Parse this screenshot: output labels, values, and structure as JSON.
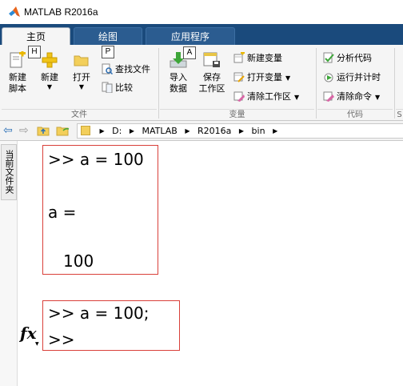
{
  "window": {
    "title": "MATLAB R2016a"
  },
  "tabs": [
    {
      "label": "主页",
      "active": true
    },
    {
      "label": "绘图",
      "active": false
    },
    {
      "label": "应用程序",
      "active": false
    }
  ],
  "keytips": {
    "h": "H",
    "p": "P",
    "a": "A"
  },
  "ribbon": {
    "file": {
      "new_script": "新建\n脚本",
      "new": "新建",
      "open": "打开",
      "find_files": "查找文件",
      "compare": "比较",
      "group_label": "文件"
    },
    "variable": {
      "import": "导入\n数据",
      "save_workspace": "保存\n工作区",
      "new_variable": "新建变量",
      "open_variable": "打开变量",
      "clear_workspace": "清除工作区",
      "group_label": "变量"
    },
    "code": {
      "analyze": "分析代码",
      "run_time": "运行并计时",
      "clear_commands": "清除命令",
      "group_label": "代码",
      "next_group_label": "S"
    }
  },
  "address": {
    "crumbs": [
      "D:",
      "MATLAB",
      "R2016a",
      "bin"
    ]
  },
  "side_panel": {
    "label": "当前文件夹"
  },
  "command_window": {
    "lines1": [
      ">> a = 100",
      "a =",
      "100"
    ],
    "lines2": [
      ">> a = 100;",
      ">>"
    ],
    "fx": "fx"
  },
  "colors": {
    "title_blue": "#1a4a7c",
    "highlight_box": "#d9403a"
  }
}
